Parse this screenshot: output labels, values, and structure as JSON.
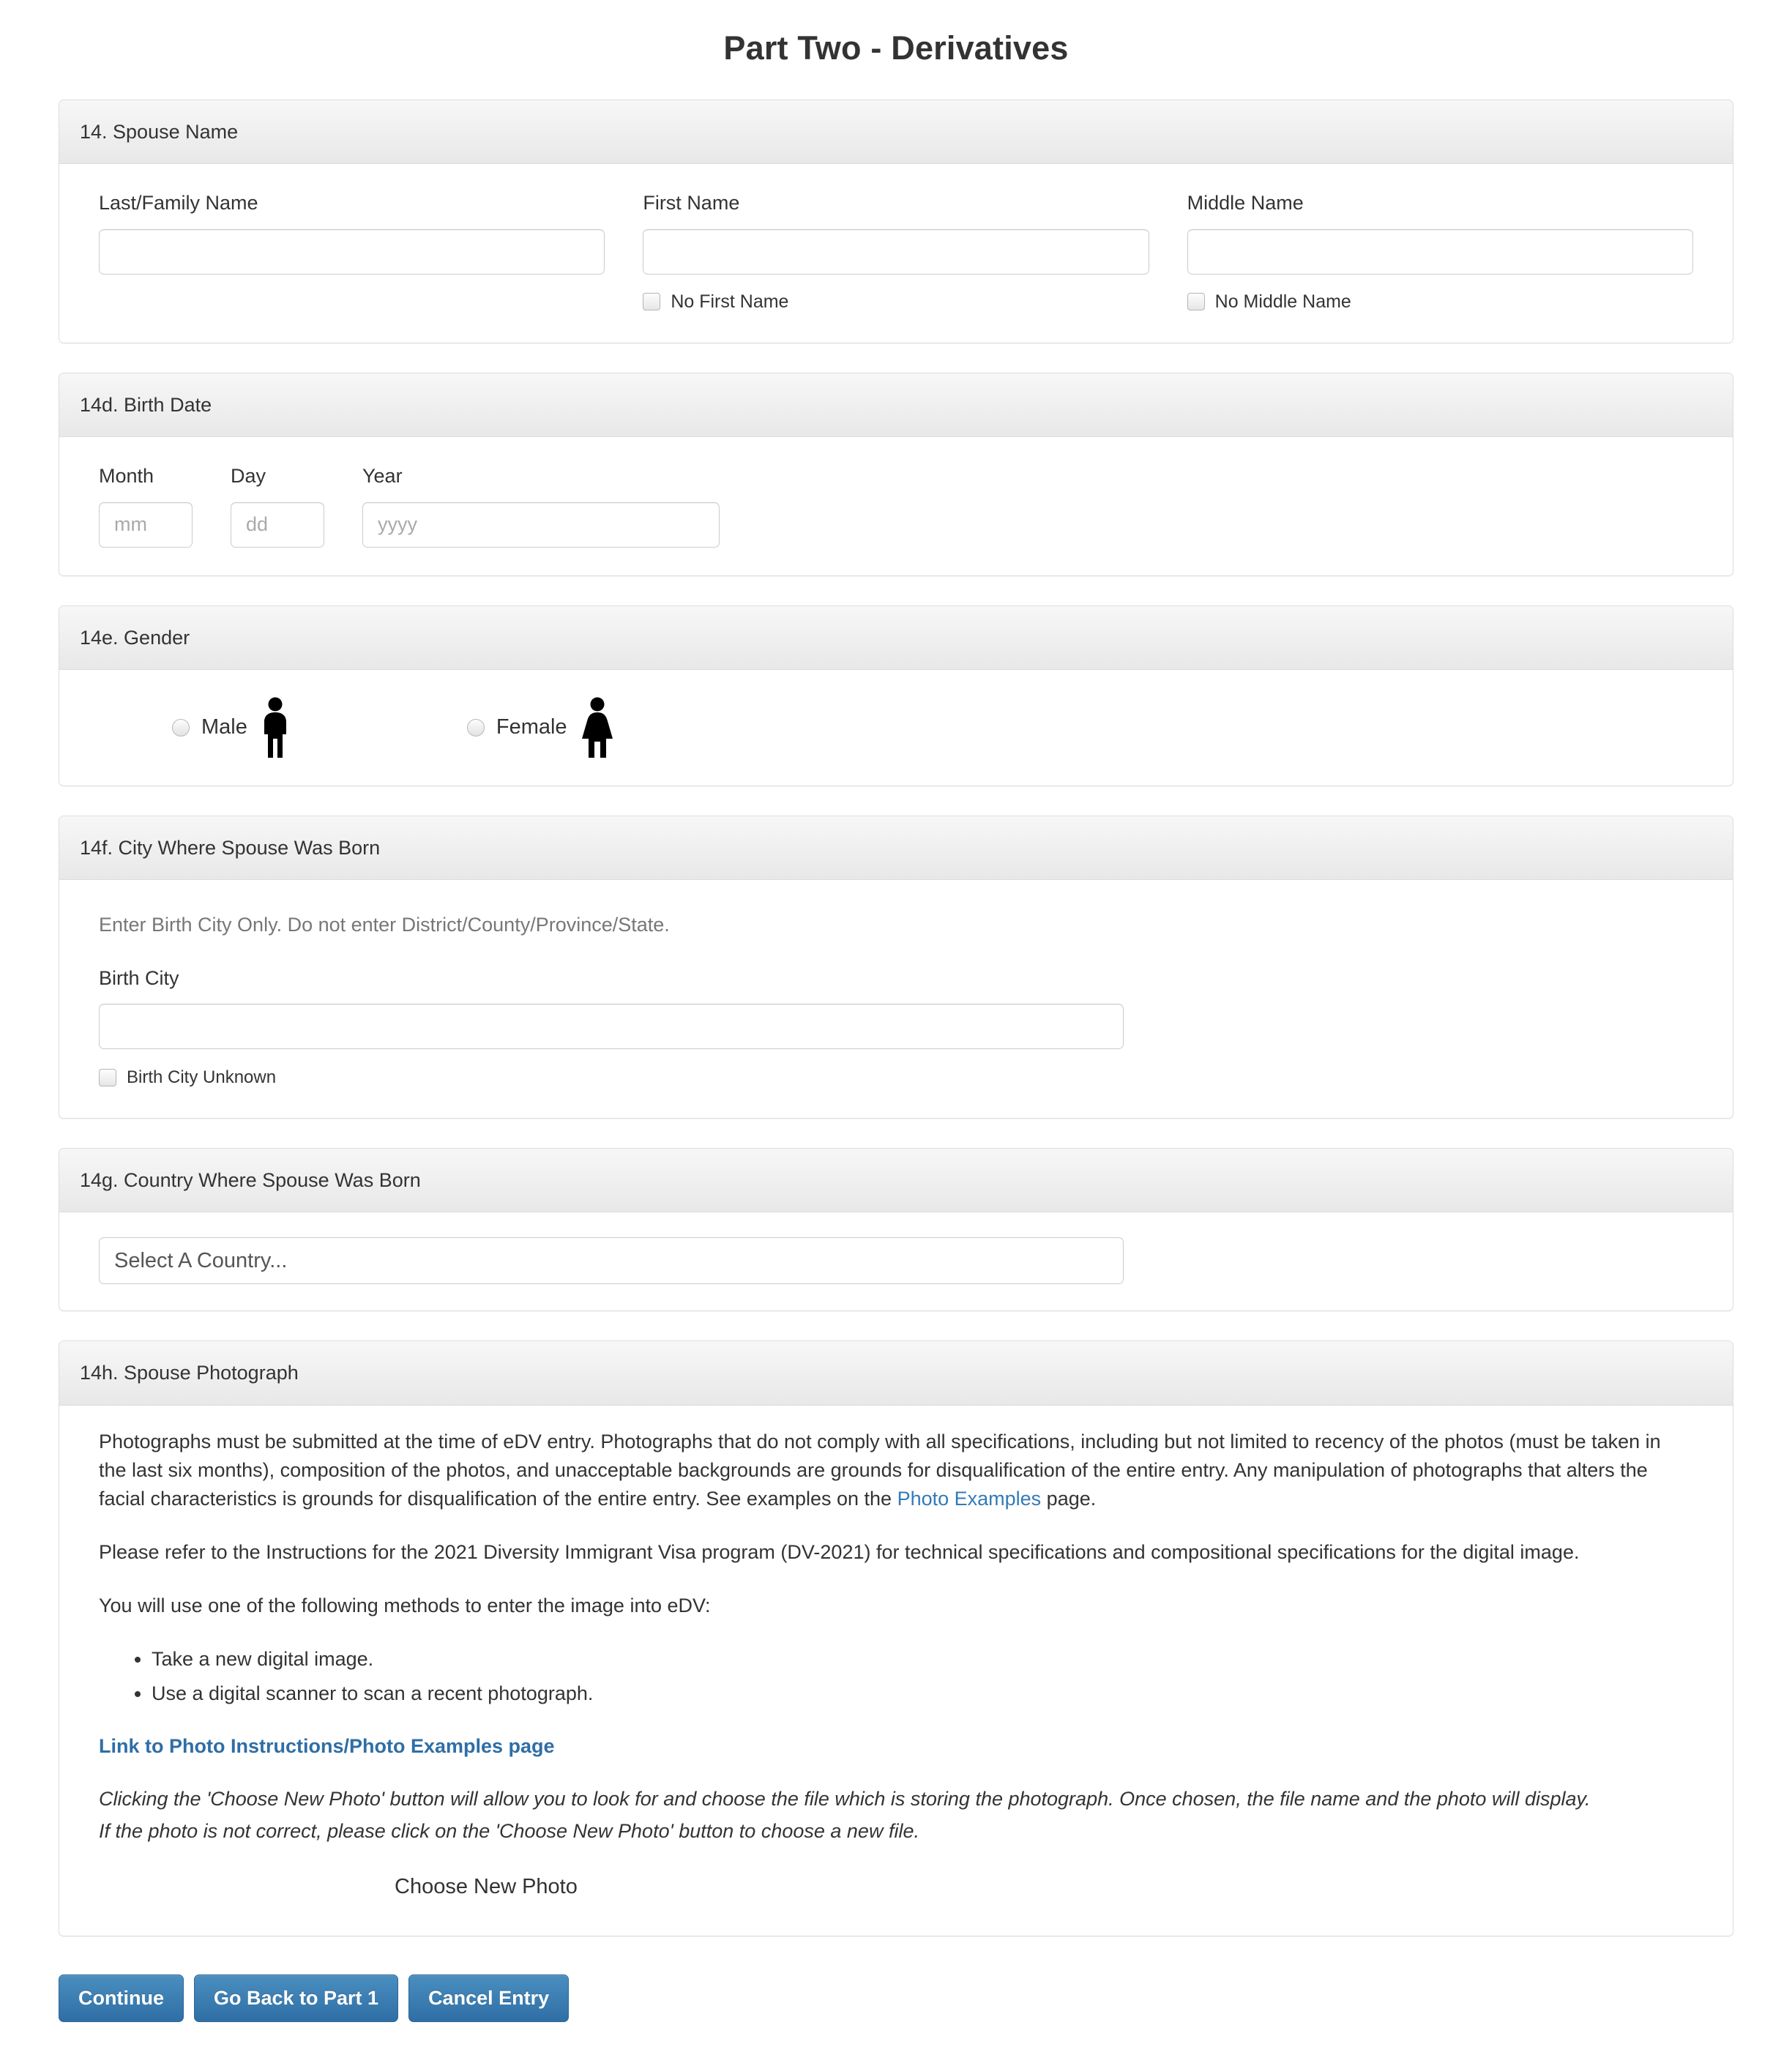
{
  "page": {
    "title": "Part Two - Derivatives"
  },
  "spouse_name": {
    "heading": "14. Spouse Name",
    "last_name": {
      "label": "Last/Family Name",
      "value": ""
    },
    "first_name": {
      "label": "First Name",
      "value": "",
      "checkbox_label": "No First Name"
    },
    "middle_name": {
      "label": "Middle Name",
      "value": "",
      "checkbox_label": "No Middle Name"
    }
  },
  "birth_date": {
    "heading": "14d. Birth Date",
    "month": {
      "label": "Month",
      "placeholder": "mm",
      "value": ""
    },
    "day": {
      "label": "Day",
      "placeholder": "dd",
      "value": ""
    },
    "year": {
      "label": "Year",
      "placeholder": "yyyy",
      "value": ""
    }
  },
  "gender": {
    "heading": "14e. Gender",
    "male_label": "Male",
    "female_label": "Female",
    "male_icon": "male-figure-icon",
    "female_icon": "female-figure-icon",
    "selected": ""
  },
  "birth_city": {
    "heading": "14f. City Where Spouse Was Born",
    "hint": "Enter Birth City Only. Do not enter District/County/Province/State.",
    "label": "Birth City",
    "value": "",
    "checkbox_label": "Birth City Unknown"
  },
  "birth_country": {
    "heading": "14g. Country Where Spouse Was Born",
    "selected": "Select A Country..."
  },
  "photograph": {
    "heading": "14h. Spouse Photograph",
    "para1_a": "Photographs must be submitted at the time of eDV entry. Photographs that do not comply with all specifications, including but not limited to recency of the photos (must be taken in the last six months), composition of the photos, and unacceptable backgrounds are grounds for disqualification of the entire entry. Any manipulation of photographs that alters the facial characteristics is grounds for disqualification of the entire entry. See examples on the ",
    "para1_link": "Photo Examples",
    "para1_b": " page.",
    "para2": "Please refer to the Instructions for the 2021 Diversity Immigrant Visa program (DV-2021) for technical specifications and compositional specifications for the digital image.",
    "para3": "You will use one of the following methods to enter the image into eDV:",
    "methods": [
      "Take a new digital image.",
      "Use a digital scanner to scan a recent photograph."
    ],
    "bold_link": "Link to Photo Instructions/Photo Examples page",
    "note1": "Clicking the 'Choose New Photo' button will allow you to look for and choose the file which is storing the photograph. Once chosen, the file name and the photo will display.",
    "note2": "If the photo is not correct, please click on the 'Choose New Photo' button to choose a new file.",
    "choose_label": "Choose New Photo"
  },
  "footer_buttons": {
    "continue": "Continue",
    "go_back": "Go Back to Part 1",
    "cancel": "Cancel Entry"
  },
  "colors": {
    "button_blue_top": "#4a8fc0",
    "button_blue_bottom": "#2f6ea5",
    "link_blue": "#337ab7",
    "panel_border": "#dddddd",
    "heading_gradient_top": "#f7f7f7",
    "heading_gradient_bottom": "#e8e8e8"
  }
}
